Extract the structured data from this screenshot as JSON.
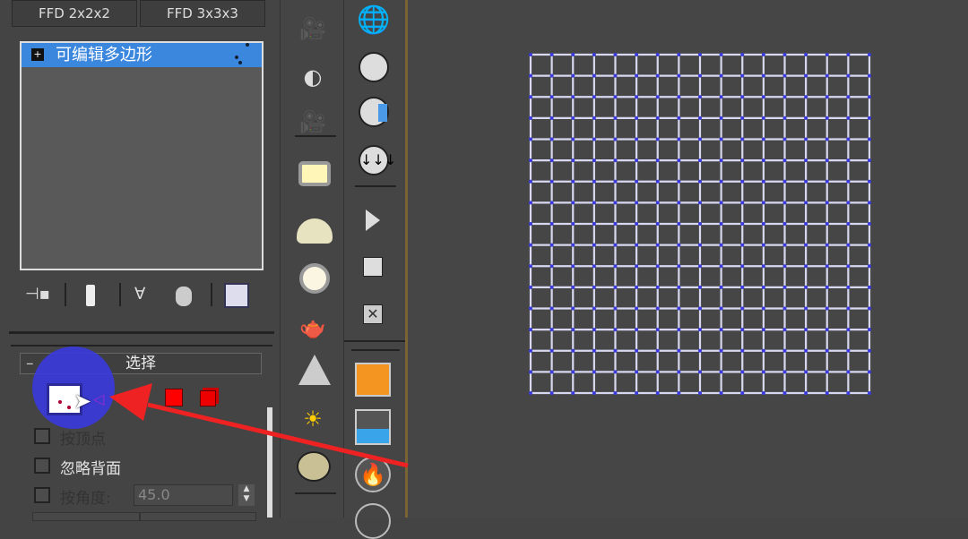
{
  "modifier_buttons": {
    "ffd2": "FFD 2x2x2",
    "ffd3": "FFD 3x3x3"
  },
  "modifier_stack": {
    "items": [
      {
        "label": "可编辑多边形",
        "expand": "+"
      }
    ]
  },
  "stack_toolbar": {
    "icons": [
      "pin-stack-icon",
      "show-end-result-icon",
      "make-unique-icon",
      "remove-modifier-icon",
      "configure-modifier-sets-icon"
    ]
  },
  "selection_rollout": {
    "title": "选择",
    "collapse": "–",
    "by_vertex": "按顶点",
    "ignore_backfacing": "忽略背面",
    "by_angle": "按角度:",
    "angle_value": "45.0"
  },
  "colors": {
    "highlight": "#3c87de",
    "grid_line": "#d8d8f0",
    "grid_vertex": "#3a3ae0",
    "arrow": "#ee2222",
    "cursor_halo": "#3a3adf"
  },
  "grid": {
    "cells": 16
  }
}
